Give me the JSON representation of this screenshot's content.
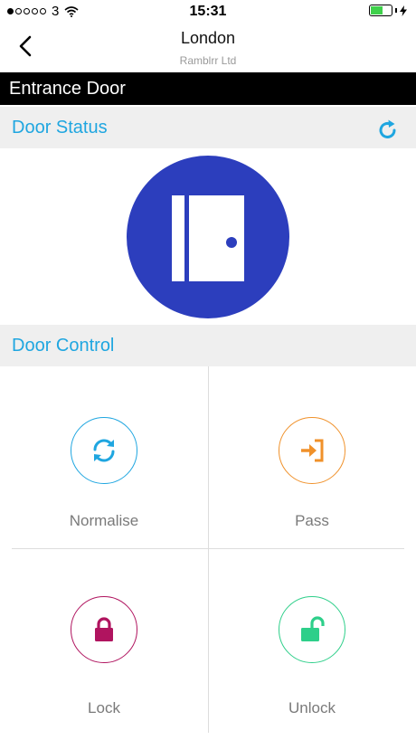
{
  "status_bar": {
    "carrier": "3",
    "time": "15:31"
  },
  "nav": {
    "title": "London",
    "subtitle": "Ramblrr Ltd"
  },
  "door": {
    "name": "Entrance Door"
  },
  "sections": {
    "status_title": "Door Status",
    "control_title": "Door Control"
  },
  "door_status": {
    "icon": "door-closed-icon",
    "color": "#2c3ebd"
  },
  "controls": [
    {
      "label": "Normalise",
      "icon": "sync-icon",
      "color": "#1fa6e0"
    },
    {
      "label": "Pass",
      "icon": "sign-in-icon",
      "color": "#f0912a"
    },
    {
      "label": "Lock",
      "icon": "lock-icon",
      "color": "#b0145f"
    },
    {
      "label": "Unlock",
      "icon": "unlock-icon",
      "color": "#2ecf8a"
    }
  ],
  "colors": {
    "accent": "#1fa6e0",
    "header_bg": "#000000",
    "section_bg": "#efefef"
  }
}
